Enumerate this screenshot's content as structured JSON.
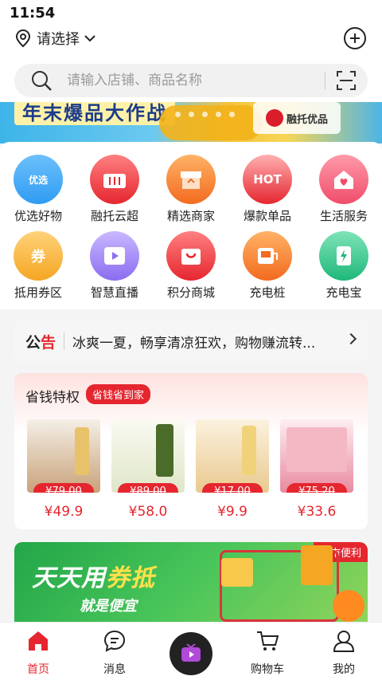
{
  "status": {
    "time": "11:54"
  },
  "header": {
    "location_label": "请选择"
  },
  "search": {
    "placeholder": "请输入店铺、商品名称"
  },
  "banner": {
    "headline": "年末爆品大作战",
    "logo_text": "融托优品"
  },
  "grid": {
    "items": [
      {
        "label": "优选好物",
        "badge": "优选",
        "color": "#2f9cf3"
      },
      {
        "label": "融托云超",
        "badge": "",
        "color": "#e5262f"
      },
      {
        "label": "精选商家",
        "badge": "",
        "color": "#f26b1f"
      },
      {
        "label": "爆款单品",
        "badge": "HOT",
        "color": "#e5262f"
      },
      {
        "label": "生活服务",
        "badge": "",
        "color": "#f04d6a"
      },
      {
        "label": "抵用券区",
        "badge": "券",
        "color": "#f5a623"
      },
      {
        "label": "智慧直播",
        "badge": "",
        "color": "#8b6cf0"
      },
      {
        "label": "积分商城",
        "badge": "",
        "color": "#e5262f"
      },
      {
        "label": "充电桩",
        "badge": "",
        "color": "#f26b1f"
      },
      {
        "label": "充电宝",
        "badge": "",
        "color": "#1fb87a"
      }
    ]
  },
  "notice": {
    "tag_black": "公",
    "tag_red": "告",
    "text": "冰爽一夏，畅享清凉狂欢，购物赚流转..."
  },
  "saver": {
    "title": "省钱特权",
    "pill": "省钱省到家",
    "products": [
      {
        "old_price": "¥79.00",
        "price": "¥49.9",
        "img_color": "#c9a27a"
      },
      {
        "old_price": "¥89.00",
        "price": "¥58.0",
        "img_color": "#4b6b2a"
      },
      {
        "old_price": "¥17.00",
        "price": "¥9.9",
        "img_color": "#e9c98f"
      },
      {
        "old_price": "¥75.20",
        "price": "¥33.6",
        "img_color": "#e98aa0"
      }
    ]
  },
  "promo": {
    "corner_label": "超市便利",
    "title_a": "天天用",
    "title_b": "券抵",
    "subtitle": "就是便宜"
  },
  "tabbar": {
    "tabs": [
      {
        "label": "首页",
        "active": true
      },
      {
        "label": "消息"
      },
      {
        "label": ""
      },
      {
        "label": "购物车"
      },
      {
        "label": "我的"
      }
    ]
  },
  "colors": {
    "accent": "#e5262f"
  }
}
